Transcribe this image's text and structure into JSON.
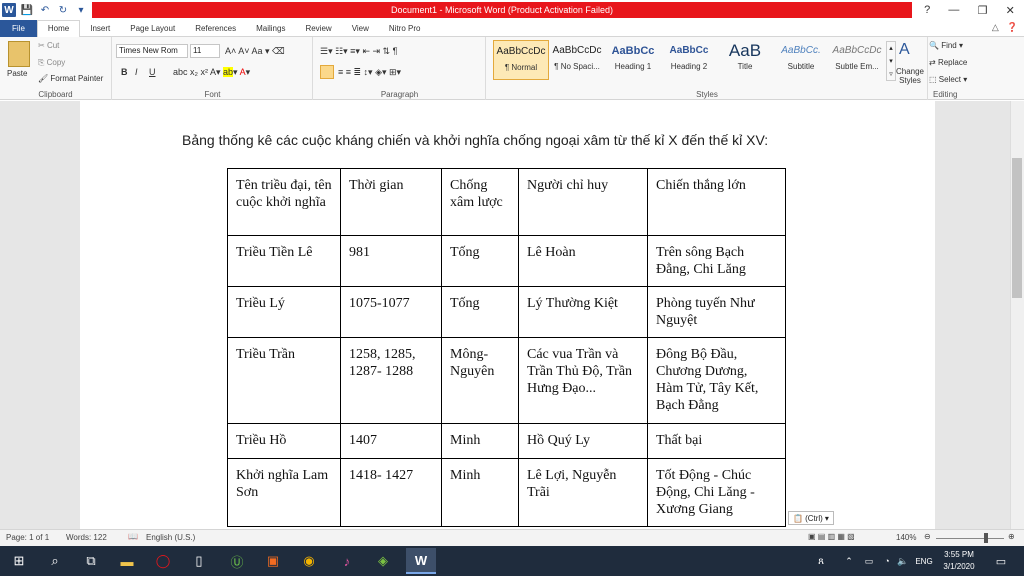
{
  "window": {
    "title": "Document1 - Microsoft Word (Product Activation Failed)",
    "logo": "W",
    "controls": [
      "?",
      "—",
      "❐",
      "✕"
    ]
  },
  "tabs": [
    "File",
    "Home",
    "Insert",
    "Page Layout",
    "References",
    "Mailings",
    "Review",
    "View",
    "Nitro Pro"
  ],
  "ribbon": {
    "clipboard": {
      "paste": "Paste",
      "cut": "Cut",
      "copy": "Copy",
      "format_painter": "Format Painter",
      "label": "Clipboard"
    },
    "font": {
      "name": "Times New Rom",
      "size": "11",
      "label": "Font",
      "bold": "B",
      "italic": "I",
      "underline": "U"
    },
    "paragraph": {
      "label": "Paragraph"
    },
    "styles": {
      "label": "Styles",
      "items": [
        {
          "preview": "AaBbCcDc",
          "name": "¶ Normal"
        },
        {
          "preview": "AaBbCcDc",
          "name": "¶ No Spaci..."
        },
        {
          "preview": "AaBbCc",
          "name": "Heading 1"
        },
        {
          "preview": "AaBbCc",
          "name": "Heading 2"
        },
        {
          "preview": "AaB",
          "name": "Title"
        },
        {
          "preview": "AaBbCc.",
          "name": "Subtitle"
        },
        {
          "preview": "AaBbCcDc",
          "name": "Subtle Em..."
        }
      ],
      "change_styles": "Change Styles"
    },
    "editing": {
      "find": "Find",
      "replace": "Replace",
      "select": "Select",
      "label": "Editing"
    }
  },
  "document": {
    "heading": "Bảng thống kê các cuộc kháng chiến và khởi nghĩa chống ngoại xâm từ thế kỉ X đến thế kỉ XV:",
    "table": {
      "headers": [
        "Tên triều đại, tên cuộc khởi nghĩa",
        "Thời gian",
        "Chống xâm lược",
        "Người chỉ huy",
        "Chiến thắng lớn"
      ],
      "rows": [
        [
          "Triều Tiền Lê",
          "981",
          "Tống",
          "Lê Hoàn",
          "Trên sông Bạch Đằng, Chi Lăng"
        ],
        [
          "Triều Lý",
          "1075-1077",
          "Tống",
          "Lý Thường Kiệt",
          "Phòng tuyến Như Nguyệt"
        ],
        [
          "Triều Trần",
          "1258, 1285, 1287- 1288",
          "Mông-Nguyên",
          "Các vua Trần và Trần Thủ Độ, Trần Hưng Đạo...",
          "Đông Bộ Đầu, Chương Dương, Hàm Tử, Tây Kết, Bạch Đằng"
        ],
        [
          "Triều Hồ",
          "1407",
          "Minh",
          "Hồ Quý Ly",
          "Thất bại"
        ],
        [
          "Khởi nghĩa Lam Sơn",
          "1418- 1427",
          "Minh",
          "Lê Lợi, Nguyễn Trãi",
          "Tốt Động - Chúc Động, Chi Lăng - Xương Giang"
        ]
      ]
    },
    "paste_options": "(Ctrl)"
  },
  "status": {
    "page": "Page: 1 of 1",
    "words": "Words: 122",
    "language": "English (U.S.)",
    "zoom": "140%"
  },
  "taskbar": {
    "lang": "ENG",
    "time": "3:55 PM",
    "date": "3/1/2020"
  }
}
